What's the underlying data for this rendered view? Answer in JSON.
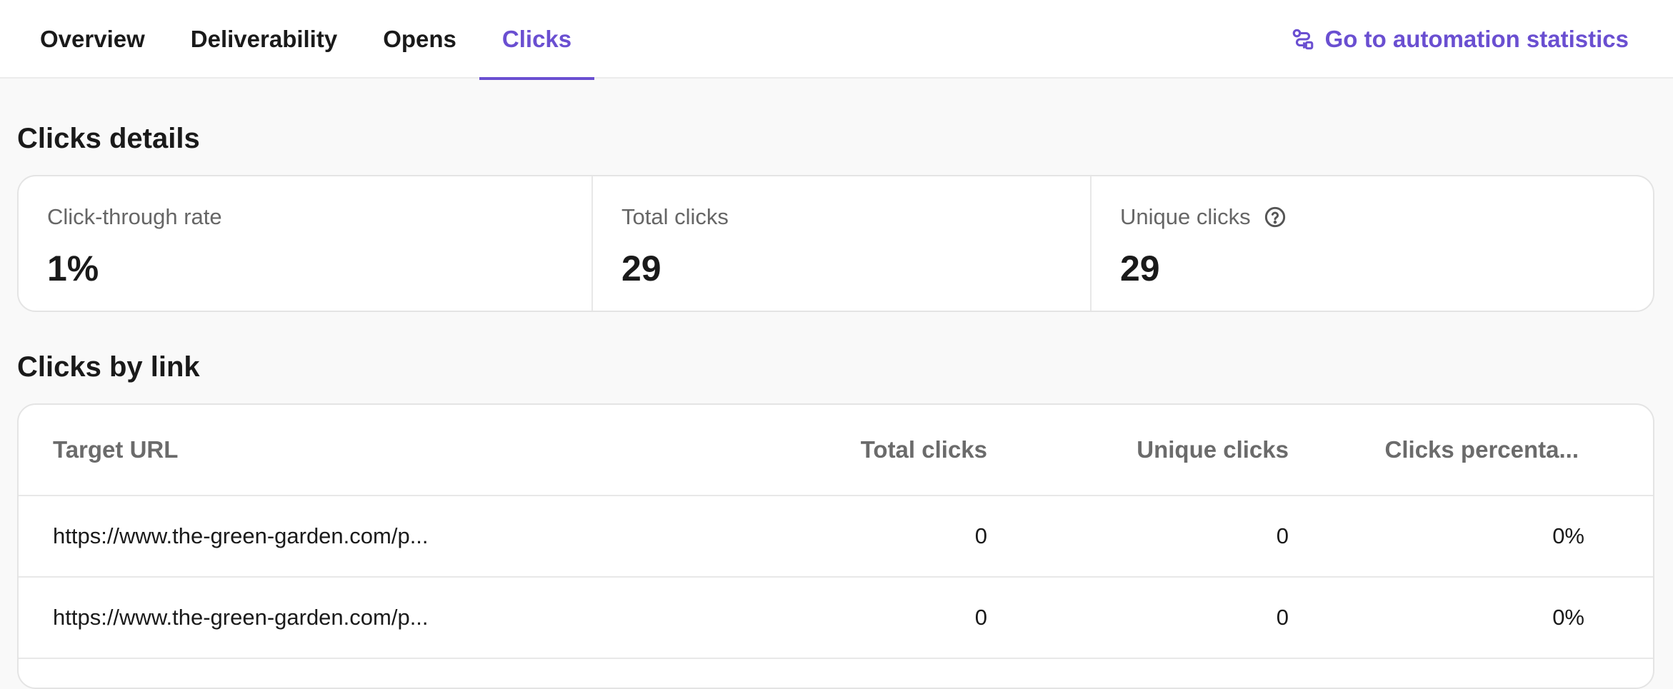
{
  "tabs": [
    {
      "label": "Overview",
      "active": false
    },
    {
      "label": "Deliverability",
      "active": false
    },
    {
      "label": "Opens",
      "active": false
    },
    {
      "label": "Clicks",
      "active": true
    }
  ],
  "automation_link": {
    "label": "Go to automation statistics",
    "icon": "automation-icon"
  },
  "clicks_details": {
    "title": "Clicks details",
    "stats": [
      {
        "label": "Click-through rate",
        "value": "1%"
      },
      {
        "label": "Total clicks",
        "value": "29"
      },
      {
        "label": "Unique clicks",
        "value": "29",
        "icon": "help-circle-icon"
      }
    ]
  },
  "clicks_by_link": {
    "title": "Clicks by link",
    "columns": [
      "Target URL",
      "Total clicks",
      "Unique clicks",
      "Clicks percenta..."
    ],
    "rows": [
      {
        "url": "https://www.the-green-garden.com/p...",
        "total": "0",
        "unique": "0",
        "percent": "0%"
      },
      {
        "url": "https://www.the-green-garden.com/p...",
        "total": "0",
        "unique": "0",
        "percent": "0%"
      }
    ]
  },
  "colors": {
    "accent": "#6a4fd1",
    "text": "#1a1a1a",
    "muted": "#666666",
    "background": "#f9f9f9",
    "border": "#e4e4e4"
  }
}
